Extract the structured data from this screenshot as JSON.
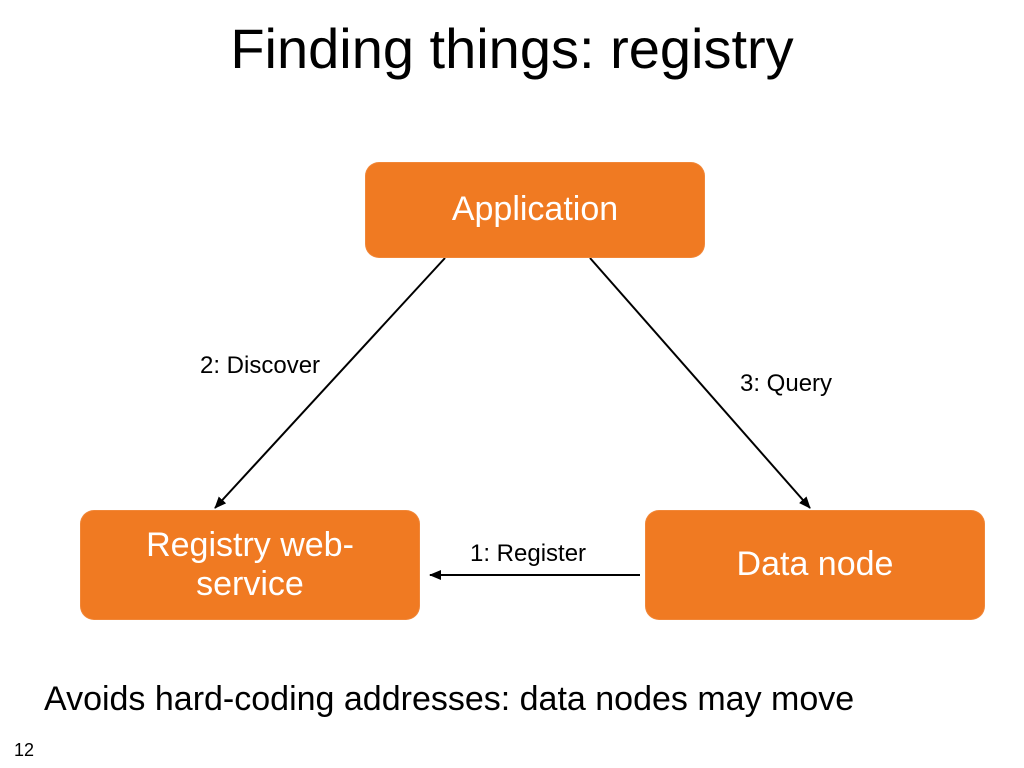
{
  "title": "Finding things: registry",
  "nodes": {
    "application": "Application",
    "registry": "Registry web-\nservice",
    "data": "Data node"
  },
  "edges": {
    "discover": "2: Discover",
    "query": "3: Query",
    "register": "1: Register"
  },
  "caption": "Avoids hard-coding addresses: data nodes may move",
  "page_number": "12",
  "colors": {
    "node_fill": "#f07a22",
    "node_text": "#ffffff",
    "arrow": "#000000"
  }
}
